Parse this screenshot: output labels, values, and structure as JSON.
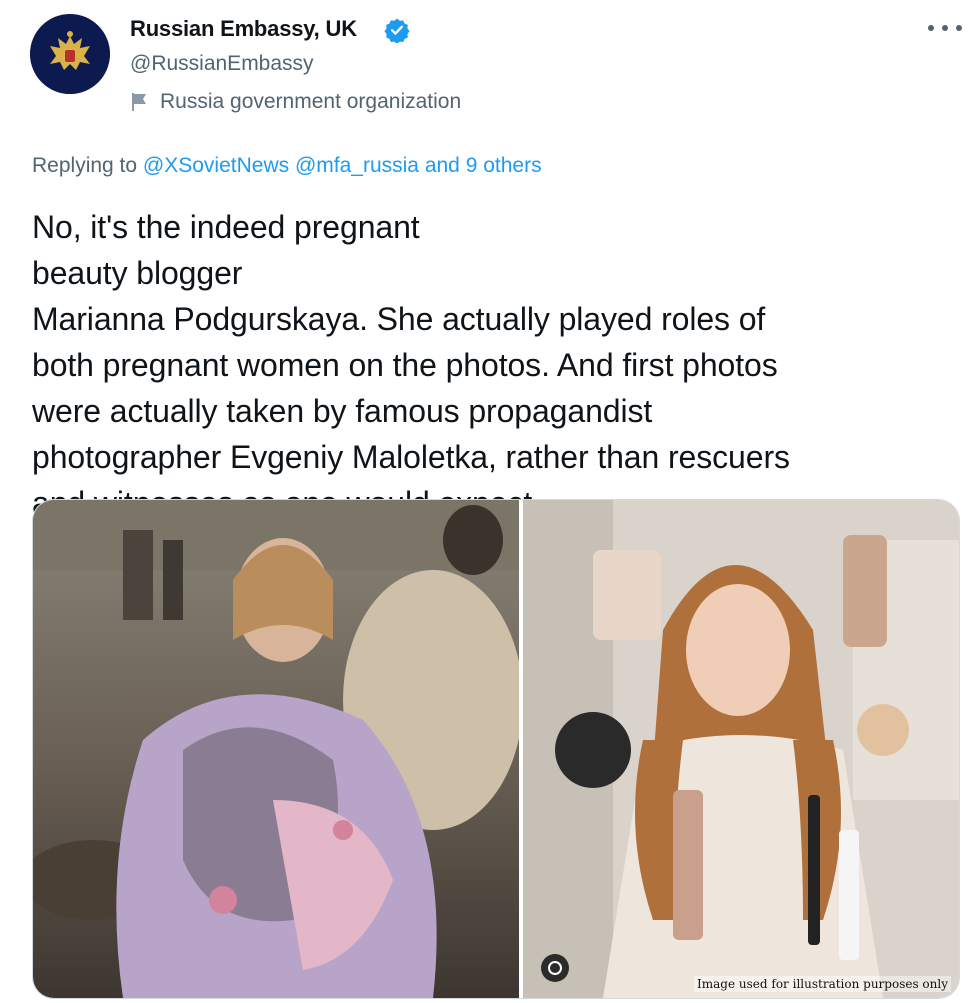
{
  "account": {
    "display_name": "Russian Embassy, UK",
    "handle": "@RussianEmbassy",
    "label": "Russia government organization",
    "verified_color": "#1d9bf0"
  },
  "reply": {
    "prefix": "Replying to ",
    "mention_1": "@XSovietNews",
    "mention_2": "@mfa_russia",
    "others": "and 9 others"
  },
  "tweet": {
    "line_1_before_flag": "No, it's the indeed pregnant ",
    "line_1_after_flag": "beauty blogger",
    "line_2": "Marianna Podgurskaya. She actually played roles of",
    "line_3": "both pregnant women on the photos. And first photos",
    "line_4": "were actually taken by famous propagandist",
    "line_5": "photographer Evgeniy Maloletka, rather than rescuers",
    "line_6": "and witnesses as one would expect."
  },
  "media": {
    "right_caption": "Image used for illustration purposes only"
  },
  "colors": {
    "text": "#0f1419",
    "secondary": "#536471",
    "accent": "#1d9bf0",
    "flag_blue": "#1e6ed8",
    "flag_yellow": "#f7cf18"
  },
  "icons": {
    "avatar": "embassy-coat-of-arms",
    "verified": "verified-badge-icon",
    "label": "government-flag-icon",
    "more": "more-dots-icon"
  }
}
